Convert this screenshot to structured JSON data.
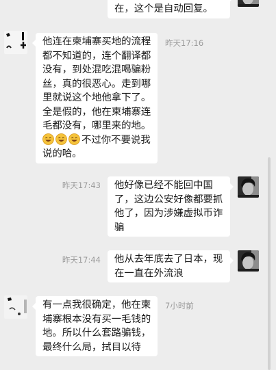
{
  "colors": {
    "background": "#ededed",
    "bubble": "#ffffff",
    "text": "#1b1b1b",
    "timestamp": "#9b9b9b"
  },
  "messages": [
    {
      "avatar_icon": "contact-photo-avatar",
      "lines": [
        "在，这个是自动回复。"
      ]
    },
    {
      "avatar_icon": "sketch-avatar",
      "time": "昨天17:16",
      "emojis": [
        "grinning-face",
        "grinning-face",
        "grinning-face"
      ],
      "lines": [
        "他连在柬埔寨买地的流程",
        "都不知道的，连个翻译都",
        "没有，到处混吃混喝骗粉",
        "丝，真的很恶心。走到哪",
        "里就说这个地他拿下了。",
        "全是假的，他在柬埔寨连",
        "毛都没有，哪里来的地。",
        "不过你不要说我",
        "说的哈。"
      ]
    },
    {
      "avatar_icon": "contact-photo-avatar",
      "time": "昨天17:43",
      "lines": [
        "他好像已经不能回中国",
        "了，这边公安好像都要抓",
        "他了，因为涉嫌虚拟币诈",
        "骗"
      ]
    },
    {
      "avatar_icon": "contact-photo-avatar",
      "time": "昨天17:44",
      "lines": [
        "他从去年底去了日本，现",
        "在一直在外流浪"
      ]
    },
    {
      "avatar_icon": "sketch-avatar",
      "time": "7小时前",
      "lines": [
        "有一点我很确定，他在柬",
        "埔寨根本没有买一毛钱的",
        "地。所以什么套路骗钱，",
        "最终什么局，拭目以待"
      ]
    }
  ]
}
